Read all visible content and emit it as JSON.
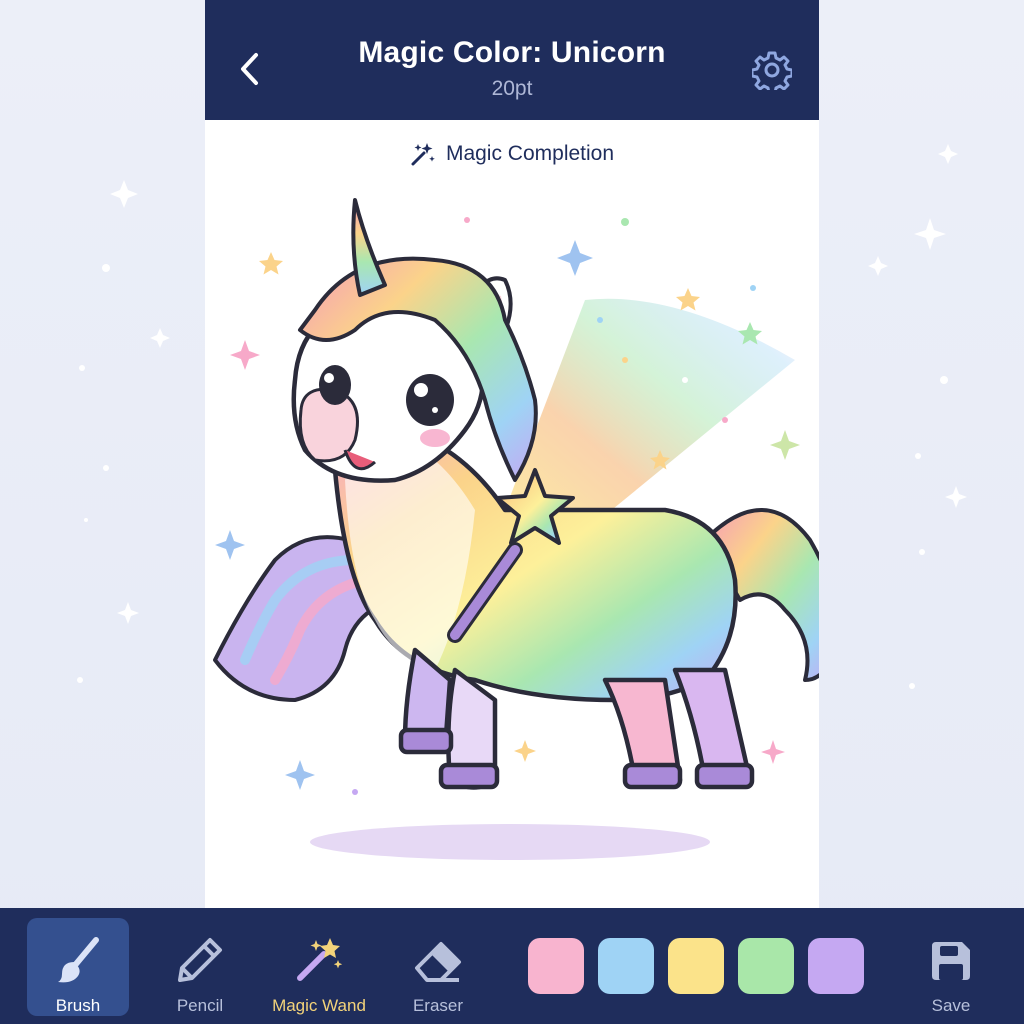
{
  "header": {
    "title": "Magic Color: Unicorn",
    "subtitle": "20pt"
  },
  "magic": {
    "label": "Magic Completion"
  },
  "toolbar": {
    "tools": [
      {
        "label": "Brush",
        "icon": "brush-icon",
        "active": true
      },
      {
        "label": "Pencil",
        "icon": "pencil-icon"
      },
      {
        "label": "Magic Wand",
        "icon": "magic-wand-icon"
      },
      {
        "label": "Eraser",
        "icon": "eraser-icon"
      }
    ],
    "swatches": [
      "#f8b4cf",
      "#9fd3f5",
      "#fbe38a",
      "#a9e7a9",
      "#c5a8f2"
    ],
    "save_label": "Save"
  },
  "colors": {
    "header_bg": "#1f2d5c",
    "accent_active": "#34508f",
    "wand_label": "#f3d37a"
  }
}
